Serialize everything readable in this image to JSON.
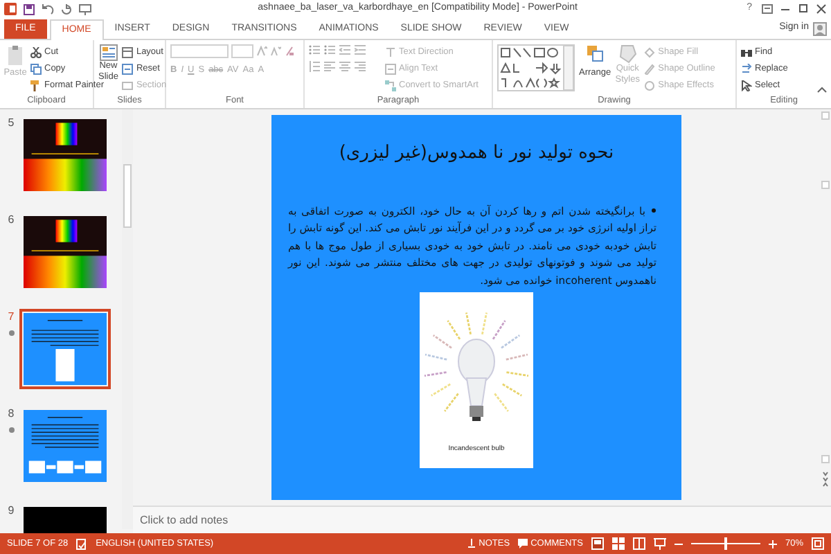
{
  "window": {
    "title": "ashnaee_ba_laser_va_karbordhaye_en [Compatibility Mode] - PowerPoint",
    "help": "?"
  },
  "tabs": [
    {
      "label": "FILE",
      "kind": "file",
      "selected": false
    },
    {
      "label": "HOME",
      "kind": "tab",
      "selected": true
    },
    {
      "label": "INSERT",
      "kind": "tab",
      "selected": false
    },
    {
      "label": "DESIGN",
      "kind": "tab",
      "selected": false
    },
    {
      "label": "TRANSITIONS",
      "kind": "tab",
      "selected": false
    },
    {
      "label": "ANIMATIONS",
      "kind": "tab",
      "selected": false
    },
    {
      "label": "SLIDE SHOW",
      "kind": "tab",
      "selected": false
    },
    {
      "label": "REVIEW",
      "kind": "tab",
      "selected": false
    },
    {
      "label": "VIEW",
      "kind": "tab",
      "selected": false
    }
  ],
  "sign_in": "Sign in",
  "ribbon": {
    "clipboard": {
      "label": "Clipboard",
      "paste": {
        "label": "Paste",
        "disabled": true
      },
      "items": [
        {
          "label": "Cut",
          "disabled": false
        },
        {
          "label": "Copy",
          "disabled": false
        },
        {
          "label": "Format Painter",
          "disabled": false
        }
      ]
    },
    "slides": {
      "label": "Slides",
      "new_slide": {
        "label": "New Slide"
      },
      "items": [
        {
          "label": "Layout",
          "disabled": false
        },
        {
          "label": "Reset",
          "disabled": false
        },
        {
          "label": "Section",
          "disabled": true
        }
      ]
    },
    "font": {
      "label": "Font",
      "buttons": [
        "B",
        "I",
        "U",
        "S",
        "abc",
        "AV",
        "Aa",
        "A"
      ]
    },
    "paragraph": {
      "label": "Paragraph",
      "items": [
        {
          "label": "Text Direction",
          "disabled": true
        },
        {
          "label": "Align Text",
          "disabled": true
        },
        {
          "label": "Convert to SmartArt",
          "disabled": true
        }
      ]
    },
    "drawing": {
      "label": "Drawing",
      "arrange": "Arrange",
      "quick_styles": {
        "label": "Quick Styles",
        "disabled": true
      },
      "items": [
        {
          "label": "Shape Fill",
          "disabled": true
        },
        {
          "label": "Shape Outline",
          "disabled": true
        },
        {
          "label": "Shape Effects",
          "disabled": true
        }
      ]
    },
    "editing": {
      "label": "Editing",
      "items": [
        {
          "label": "Find",
          "disabled": false
        },
        {
          "label": "Replace",
          "disabled": false
        },
        {
          "label": "Select",
          "disabled": false
        }
      ]
    }
  },
  "thumbnails": [
    {
      "number": "5",
      "kind": "spectrum",
      "selected": false,
      "animated": false
    },
    {
      "number": "6",
      "kind": "spectrum",
      "selected": false,
      "animated": false
    },
    {
      "number": "7",
      "kind": "text-picture",
      "selected": true,
      "animated": true
    },
    {
      "number": "8",
      "kind": "text-diagram",
      "selected": false,
      "animated": true
    },
    {
      "number": "9",
      "kind": "dark",
      "selected": false,
      "animated": false
    }
  ],
  "slide": {
    "title": "نحوه تولید نور نا همدوس(غیر لیزری)",
    "bullets": [
      "با برانگیخته شدن اتم و رها کردن آن به حال خود، الکترون به صورت اتفاقی به تراز اولیه انرژی خود بر می گردد و در این فرآیند نور تابش می کند. این گونه تابش را تابش خودبه خودی می نامند. در تابش خود به خودی بسیاری از طول موج ها با هم تولید می شوند و فوتونهای تولیدی در جهت های مختلف منتشر می شوند. این نور ناهمدوس incoherent خوانده می شود."
    ],
    "picture": {
      "caption": "Incandescent bulb"
    }
  },
  "notes": {
    "placeholder": "Click to add notes"
  },
  "status_bar": {
    "slide": "SLIDE 7 OF 28",
    "language": "ENGLISH (UNITED STATES)",
    "notes": "NOTES",
    "comments": "COMMENTS",
    "zoom": {
      "level": 0.5,
      "reading": "70%"
    }
  }
}
